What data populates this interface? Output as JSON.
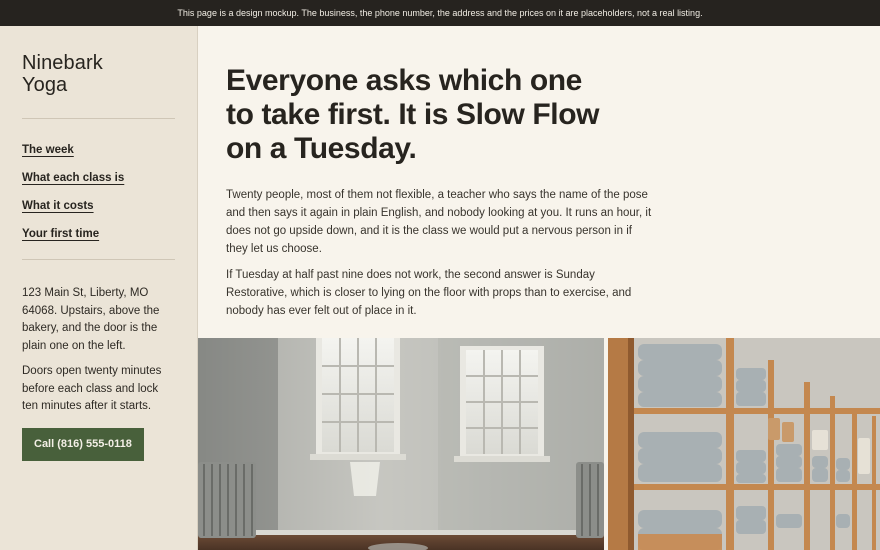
{
  "notice": "This page is a design mockup. The business, the phone number, the address and the prices on it are placeholders, not a real listing.",
  "brand": {
    "line1": "Ninebark",
    "line2": "Yoga"
  },
  "nav": [
    {
      "label": "The week"
    },
    {
      "label": "What each class is"
    },
    {
      "label": "What it costs"
    },
    {
      "label": "Your first time"
    }
  ],
  "address": "123 Main St, Liberty, MO 64068. Upstairs, above the bakery, and the door is the plain one on the left.",
  "doors": "Doors open twenty minutes before each class and lock ten minutes after it starts.",
  "call_button": "Call (816) 555-0118",
  "headline": {
    "line1": "Everyone asks which one",
    "line2": "to take first. It is Slow Flow",
    "line3": "on a Tuesday."
  },
  "paragraphs": [
    "Twenty people, most of them not flexible, a teacher who says the name of the pose and then says it again in plain English, and nobody looking at you. It runs an hour, it does not go upside down, and it is the class we would put a nervous person in if they let us choose.",
    "If Tuesday at half past nine does not work, the second answer is Sunday Restorative, which is closer to lying on the floor with props than to exercise, and nobody has ever felt out of place in it."
  ],
  "colors": {
    "topbar": "#26231f",
    "sidebar": "#ebe4d7",
    "page": "#f8f4ec",
    "button": "#48603b",
    "text": "#27241f"
  }
}
